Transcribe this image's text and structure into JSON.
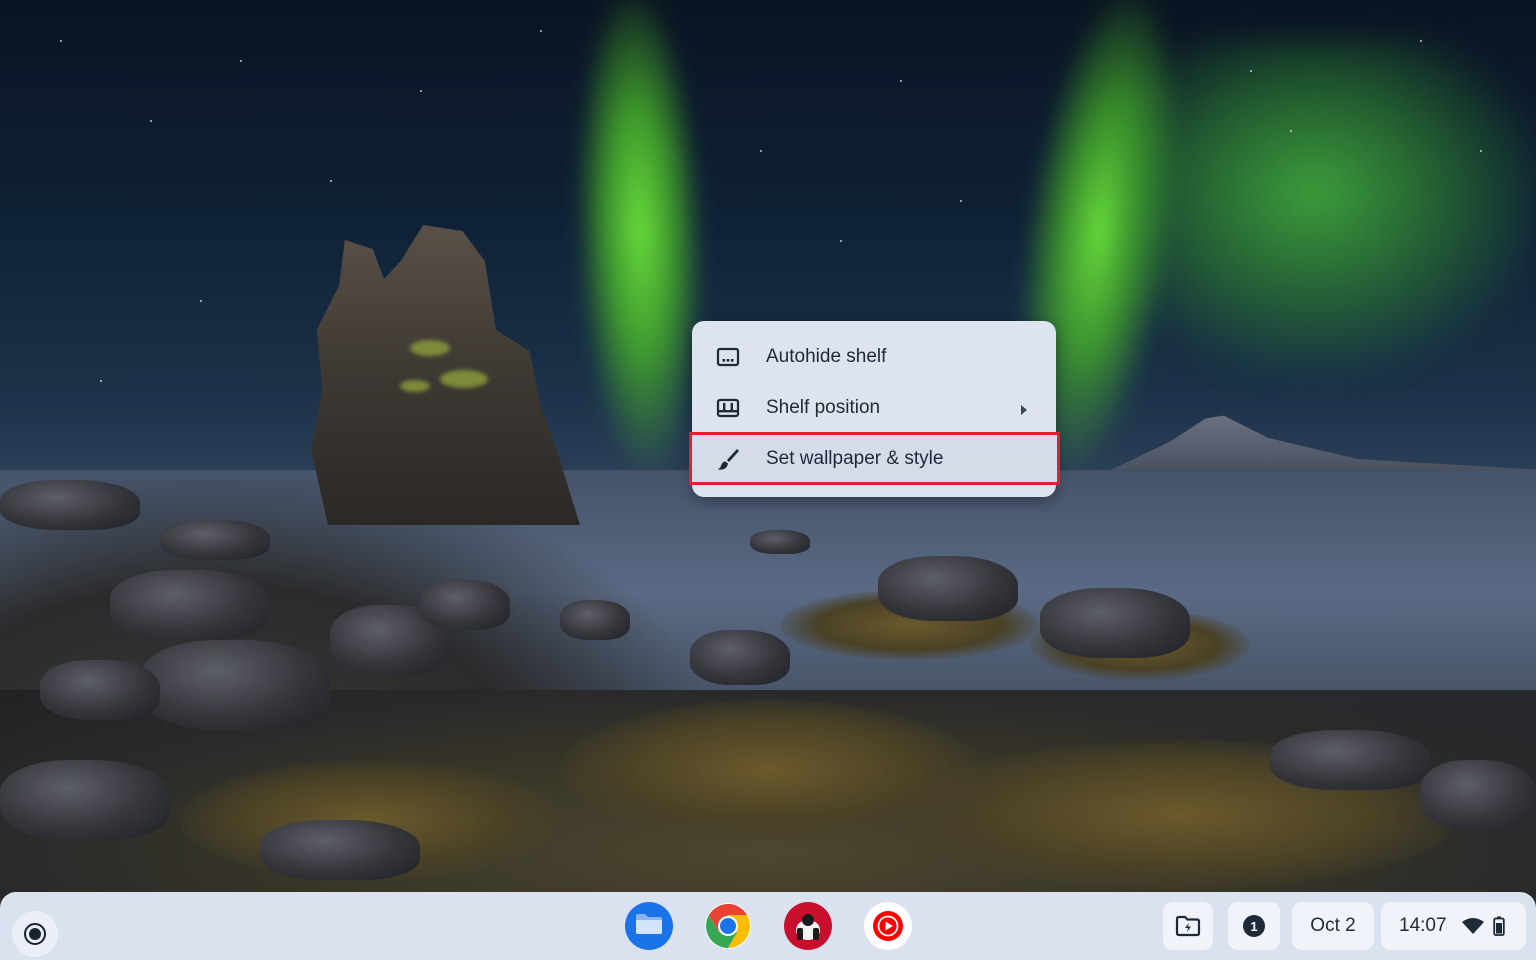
{
  "desktop": {
    "wallpaper": "aurora-coast"
  },
  "context_menu": {
    "items": [
      {
        "label": "Autohide shelf",
        "icon": "autohide-shelf-icon"
      },
      {
        "label": "Shelf position",
        "icon": "shelf-position-icon",
        "submenu": true
      },
      {
        "label": "Set wallpaper & style",
        "icon": "paintbrush-icon",
        "highlighted": true
      }
    ],
    "highlight_color": "#e0202a"
  },
  "shelf": {
    "launcher_icon": "launcher-icon",
    "apps": [
      {
        "name": "Files",
        "icon": "files-icon"
      },
      {
        "name": "Google Chrome",
        "icon": "chrome-icon"
      },
      {
        "name": "Game",
        "icon": "game-app-icon"
      },
      {
        "name": "YouTube Music",
        "icon": "youtube-music-icon"
      }
    ],
    "tray": {
      "holding_space_icon": "holding-space-icon",
      "notification_count": "1",
      "date": "Oct 2",
      "time": "14:07",
      "wifi_icon": "wifi-icon",
      "battery_icon": "battery-icon"
    }
  }
}
